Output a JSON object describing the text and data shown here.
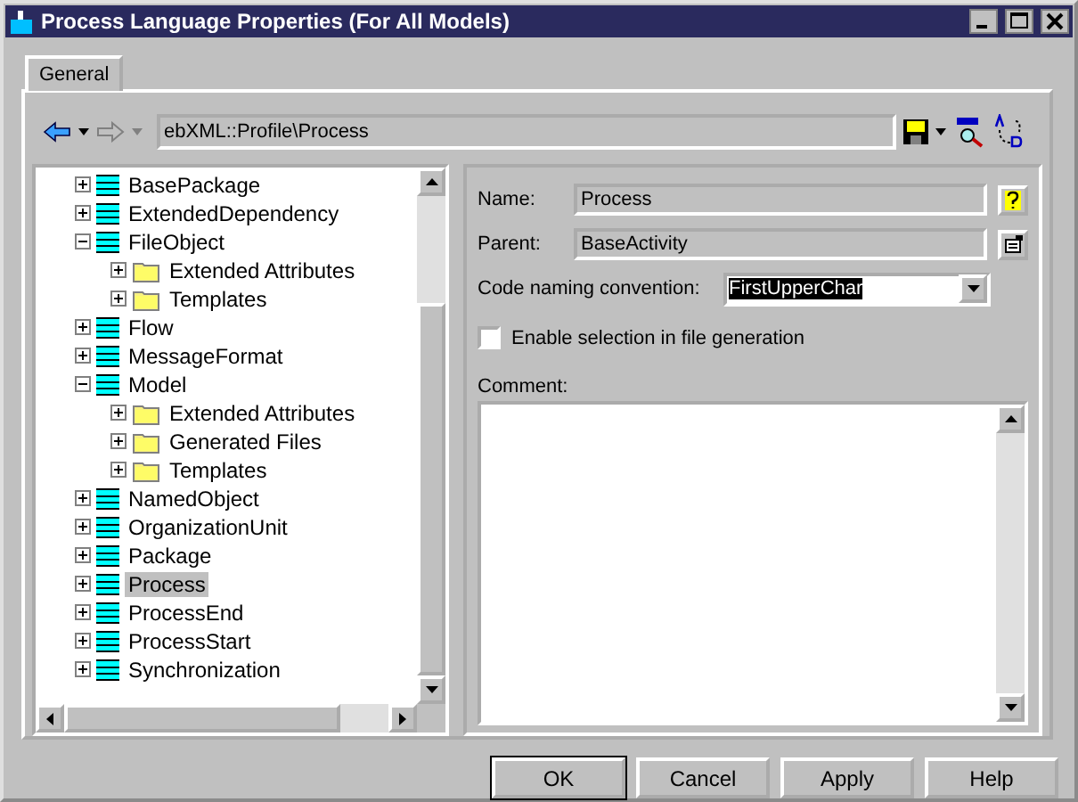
{
  "window": {
    "title": "Process Language Properties (For All Models)"
  },
  "tabs": [
    {
      "label": "General",
      "selected": true
    }
  ],
  "toolbar": {
    "path": "ebXML::Profile\\Process"
  },
  "tree": [
    {
      "label": "BasePackage",
      "kind": "class",
      "expanded": false,
      "selected": false
    },
    {
      "label": "ExtendedDependency",
      "kind": "class",
      "expanded": false,
      "selected": false
    },
    {
      "label": "FileObject",
      "kind": "class",
      "expanded": true,
      "selected": false,
      "children": [
        {
          "label": "Extended Attributes",
          "kind": "folder",
          "expanded": false,
          "selected": false
        },
        {
          "label": "Templates",
          "kind": "folder",
          "expanded": false,
          "selected": false
        }
      ]
    },
    {
      "label": "Flow",
      "kind": "class",
      "expanded": false,
      "selected": false
    },
    {
      "label": "MessageFormat",
      "kind": "class",
      "expanded": false,
      "selected": false
    },
    {
      "label": "Model",
      "kind": "class",
      "expanded": true,
      "selected": false,
      "children": [
        {
          "label": "Extended Attributes",
          "kind": "folder",
          "expanded": false,
          "selected": false
        },
        {
          "label": "Generated Files",
          "kind": "folder",
          "expanded": false,
          "selected": false
        },
        {
          "label": "Templates",
          "kind": "folder",
          "expanded": false,
          "selected": false
        }
      ]
    },
    {
      "label": "NamedObject",
      "kind": "class",
      "expanded": false,
      "selected": false
    },
    {
      "label": "OrganizationUnit",
      "kind": "class",
      "expanded": false,
      "selected": false
    },
    {
      "label": "Package",
      "kind": "class",
      "expanded": false,
      "selected": false
    },
    {
      "label": "Process",
      "kind": "class",
      "expanded": false,
      "selected": true
    },
    {
      "label": "ProcessEnd",
      "kind": "class",
      "expanded": false,
      "selected": false
    },
    {
      "label": "ProcessStart",
      "kind": "class",
      "expanded": false,
      "selected": false
    },
    {
      "label": "Synchronization",
      "kind": "class",
      "expanded": false,
      "selected": false
    }
  ],
  "form": {
    "name_label": "Name:",
    "name": "Process",
    "parent_label": "Parent:",
    "parent": "BaseActivity",
    "convention_label": "Code naming convention:",
    "convention": "FirstUpperChar",
    "enable": {
      "label": "Enable selection in file generation",
      "checked": false
    },
    "comment_label": "Comment:"
  },
  "buttons": [
    {
      "label": "OK",
      "default": true
    },
    {
      "label": "Cancel",
      "default": false
    },
    {
      "label": "Apply",
      "default": false
    },
    {
      "label": "Help",
      "default": false
    }
  ]
}
